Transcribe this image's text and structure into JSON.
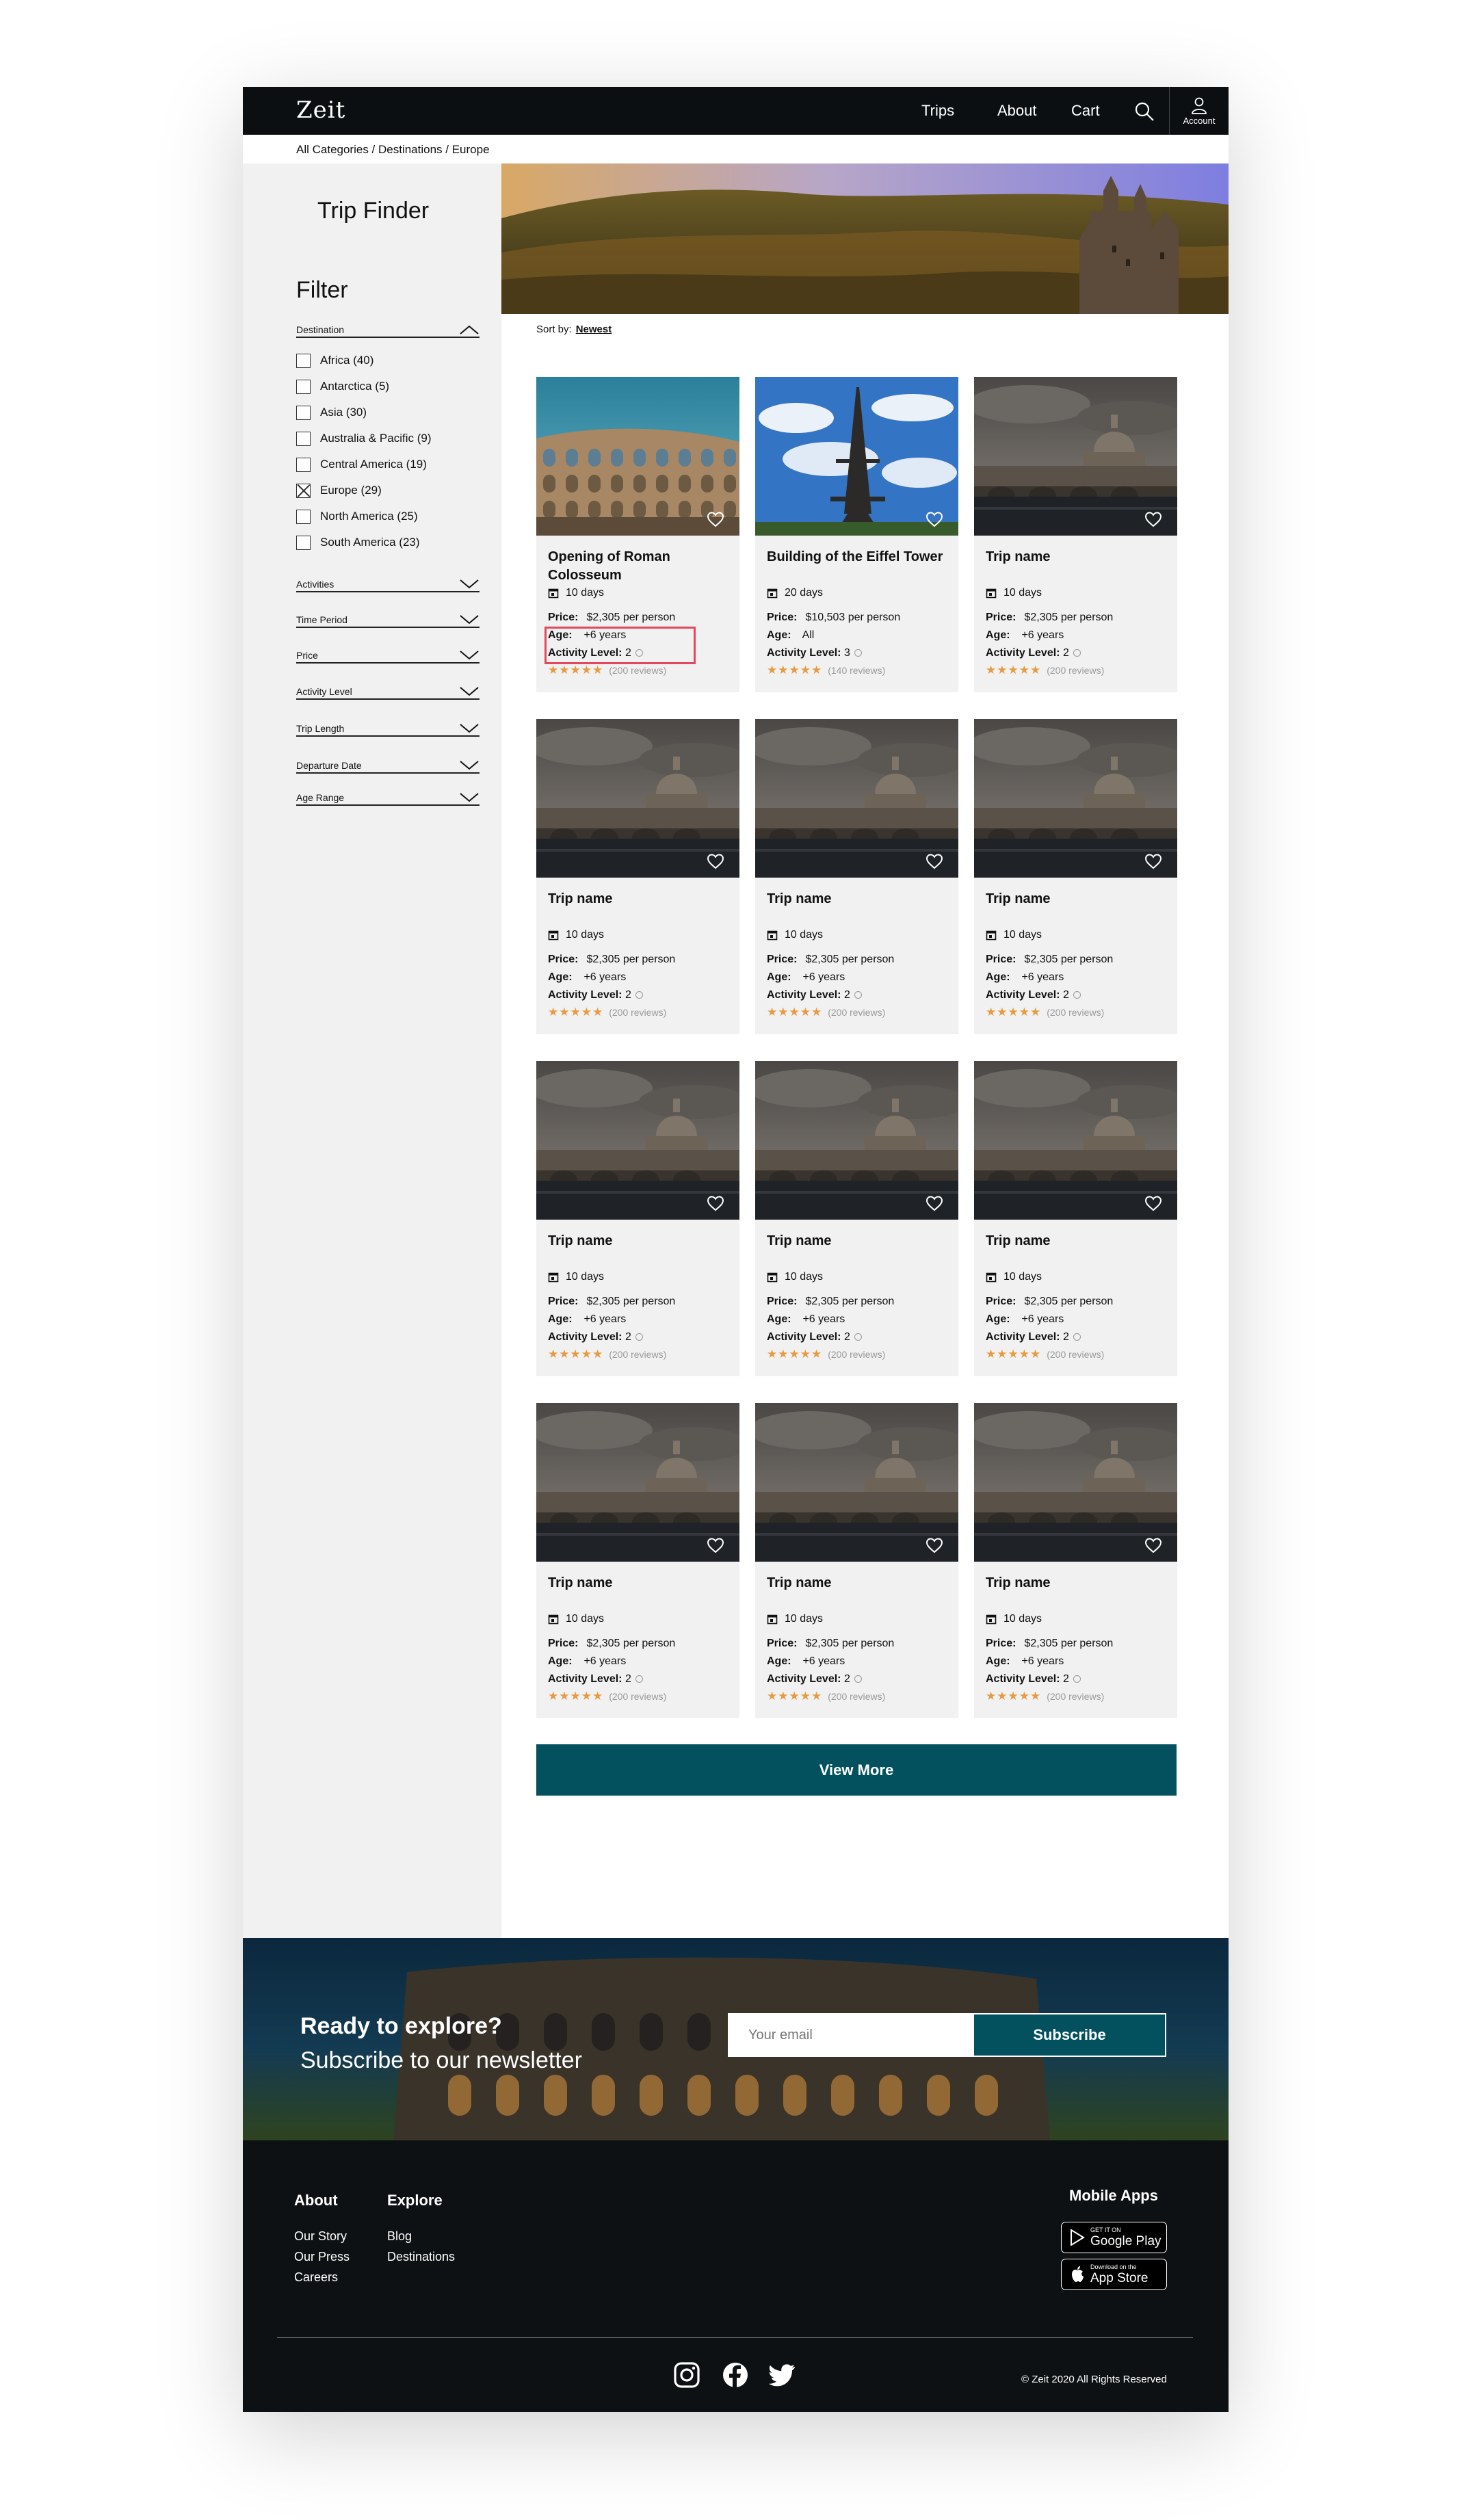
{
  "brand": {
    "logo": "Zeit"
  },
  "nav": {
    "trips": "Trips",
    "about": "About",
    "cart": "Cart",
    "account": "Account"
  },
  "breadcrumb": "All Categories / Destinations / Europe",
  "sidebar": {
    "title": "Trip Finder",
    "filter_title": "Filter",
    "destination_label": "Destination",
    "destinations": [
      {
        "label": "Africa (40)",
        "checked": false
      },
      {
        "label": "Antarctica (5)",
        "checked": false
      },
      {
        "label": "Asia (30)",
        "checked": false
      },
      {
        "label": "Australia & Pacific (9)",
        "checked": false
      },
      {
        "label": "Central America (19)",
        "checked": false
      },
      {
        "label": "Europe (29)",
        "checked": true
      },
      {
        "label": "North America (25)",
        "checked": false
      },
      {
        "label": "South America (23)",
        "checked": false
      }
    ],
    "sections": [
      "Activities",
      "Time Period",
      "Price",
      "Activity Level",
      "Trip Length",
      "Departure Date",
      "Age Range"
    ]
  },
  "sort": {
    "label": "Sort by:",
    "value": "Newest"
  },
  "cards": [
    {
      "title": "Opening of Roman Colosseum",
      "duration": "10 days",
      "price_label": "Price:",
      "price": "$2,305 per person",
      "age_label": "Age:",
      "age": "+6 years",
      "activity_label": "Activity Level:",
      "activity": "2",
      "stars": "★★★★★",
      "reviews": "(200 reviews)",
      "image": "colosseum",
      "highlighted": true
    },
    {
      "title": "Building of the Eiffel Tower",
      "duration": "20 days",
      "price_label": "Price:",
      "price": "$10,503 per person",
      "age_label": "Age:",
      "age": "All",
      "activity_label": "Activity Level:",
      "activity": "3",
      "stars": "★★★★★",
      "reviews": "(140 reviews)",
      "image": "eiffel",
      "highlighted": false
    },
    {
      "title": "Trip name",
      "duration": "10 days",
      "price_label": "Price:",
      "price": "$2,305 per person",
      "age_label": "Age:",
      "age": "+6 years",
      "activity_label": "Activity Level:",
      "activity": "2",
      "stars": "★★★★★",
      "reviews": "(200 reviews)",
      "image": "rome",
      "highlighted": false
    },
    {
      "title": "Trip name",
      "duration": "10 days",
      "price_label": "Price:",
      "price": "$2,305 per person",
      "age_label": "Age:",
      "age": "+6 years",
      "activity_label": "Activity Level:",
      "activity": "2",
      "stars": "★★★★★",
      "reviews": "(200 reviews)",
      "image": "rome",
      "highlighted": false
    },
    {
      "title": "Trip name",
      "duration": "10 days",
      "price_label": "Price:",
      "price": "$2,305 per person",
      "age_label": "Age:",
      "age": "+6 years",
      "activity_label": "Activity Level:",
      "activity": "2",
      "stars": "★★★★★",
      "reviews": "(200 reviews)",
      "image": "rome",
      "highlighted": false
    },
    {
      "title": "Trip name",
      "duration": "10 days",
      "price_label": "Price:",
      "price": "$2,305 per person",
      "age_label": "Age:",
      "age": "+6 years",
      "activity_label": "Activity Level:",
      "activity": "2",
      "stars": "★★★★★",
      "reviews": "(200 reviews)",
      "image": "rome",
      "highlighted": false
    },
    {
      "title": "Trip name",
      "duration": "10 days",
      "price_label": "Price:",
      "price": "$2,305 per person",
      "age_label": "Age:",
      "age": "+6 years",
      "activity_label": "Activity Level:",
      "activity": "2",
      "stars": "★★★★★",
      "reviews": "(200 reviews)",
      "image": "rome",
      "highlighted": false
    },
    {
      "title": "Trip name",
      "duration": "10 days",
      "price_label": "Price:",
      "price": "$2,305 per person",
      "age_label": "Age:",
      "age": "+6 years",
      "activity_label": "Activity Level:",
      "activity": "2",
      "stars": "★★★★★",
      "reviews": "(200 reviews)",
      "image": "rome",
      "highlighted": false
    },
    {
      "title": "Trip name",
      "duration": "10 days",
      "price_label": "Price:",
      "price": "$2,305 per person",
      "age_label": "Age:",
      "age": "+6 years",
      "activity_label": "Activity Level:",
      "activity": "2",
      "stars": "★★★★★",
      "reviews": "(200 reviews)",
      "image": "rome",
      "highlighted": false
    },
    {
      "title": "Trip name",
      "duration": "10 days",
      "price_label": "Price:",
      "price": "$2,305 per person",
      "age_label": "Age:",
      "age": "+6 years",
      "activity_label": "Activity Level:",
      "activity": "2",
      "stars": "★★★★★",
      "reviews": "(200 reviews)",
      "image": "rome",
      "highlighted": false
    },
    {
      "title": "Trip name",
      "duration": "10 days",
      "price_label": "Price:",
      "price": "$2,305 per person",
      "age_label": "Age:",
      "age": "+6 years",
      "activity_label": "Activity Level:",
      "activity": "2",
      "stars": "★★★★★",
      "reviews": "(200 reviews)",
      "image": "rome",
      "highlighted": false
    },
    {
      "title": "Trip name",
      "duration": "10 days",
      "price_label": "Price:",
      "price": "$2,305 per person",
      "age_label": "Age:",
      "age": "+6 years",
      "activity_label": "Activity Level:",
      "activity": "2",
      "stars": "★★★★★",
      "reviews": "(200 reviews)",
      "image": "rome",
      "highlighted": false
    }
  ],
  "view_more": "View More",
  "newsletter": {
    "title": "Ready to explore?",
    "subtitle": "Subscribe to our newsletter",
    "placeholder": "Your email",
    "button": "Subscribe"
  },
  "footer": {
    "about_title": "About",
    "about_links": [
      "Our Story",
      "Our Press",
      "Careers"
    ],
    "explore_title": "Explore",
    "explore_links": [
      "Blog",
      "Destinations"
    ],
    "mobile_title": "Mobile Apps",
    "google_small": "GET IT ON",
    "google_big": "Google Play",
    "apple_small": "Download on the",
    "apple_big": "App Store",
    "copyright": "© Zeit 2020 All Rights Reserved"
  },
  "colors": {
    "accent": "#03515f",
    "dark": "#0c0f12",
    "sidebar_bg": "#f1f1f1",
    "star": "#e79a3f",
    "highlight": "#e4485e"
  }
}
